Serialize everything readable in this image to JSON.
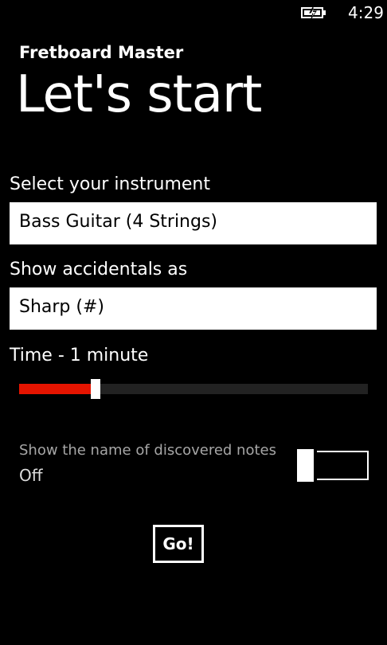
{
  "status_bar": {
    "time": "4:29",
    "battery_icon": "battery-charging-icon"
  },
  "app": {
    "title": "Fretboard Master"
  },
  "page": {
    "title": "Let's start"
  },
  "instrument": {
    "label": "Select your instrument",
    "value": "Bass Guitar (4 Strings)"
  },
  "accidentals": {
    "label": "Show accidentals as",
    "value": "Sharp (#)"
  },
  "time_setting": {
    "label": "Time - 1 minute",
    "slider_fraction": 0.21,
    "fill_color": "#e51400"
  },
  "show_names": {
    "caption": "Show the name of discovered notes",
    "state": "Off"
  },
  "go_button": {
    "label": "Go!"
  }
}
